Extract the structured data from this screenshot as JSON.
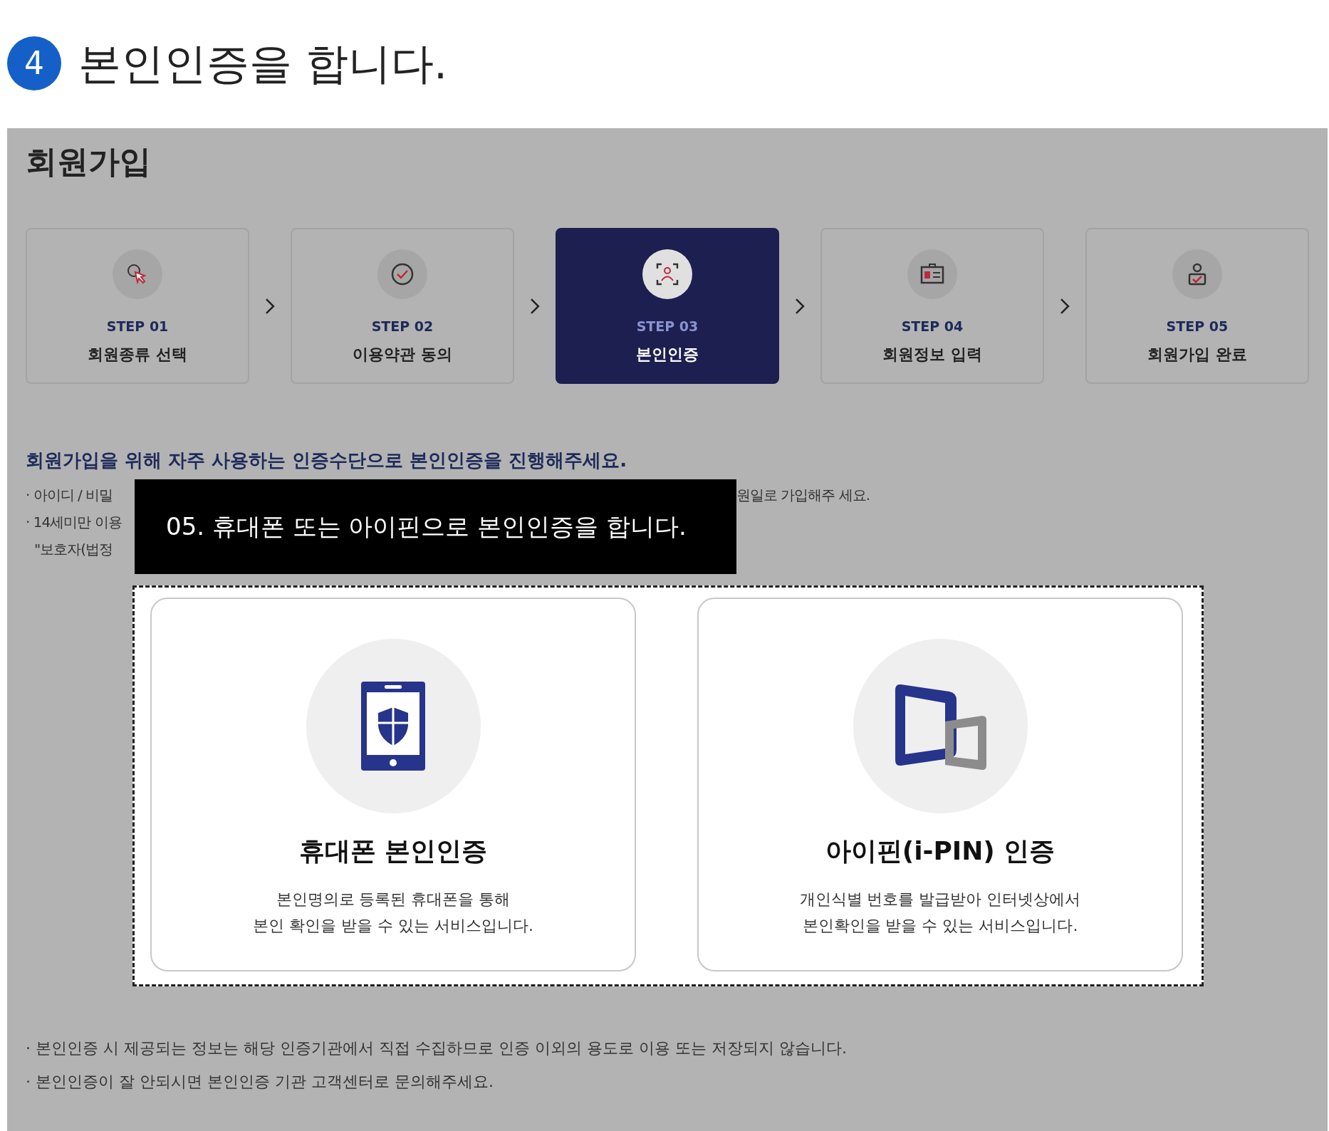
{
  "header": {
    "number": "4",
    "title": "본인인증을 합니다."
  },
  "panel": {
    "title": "회원가입",
    "steps": [
      {
        "label": "STEP 01",
        "name": "회원종류 선택",
        "selected": false
      },
      {
        "label": "STEP 02",
        "name": "이용약관 동의",
        "selected": false
      },
      {
        "label": "STEP 03",
        "name": "본인인증",
        "selected": true
      },
      {
        "label": "STEP 04",
        "name": "회원정보 입력",
        "selected": false
      },
      {
        "label": "STEP 05",
        "name": "회원가입 완료",
        "selected": false
      }
    ],
    "intro": "회원가입을 위해 자주 사용하는 인증수단으로 본인인증을 진행해주세요.",
    "notes": [
      {
        "left": "· 아이디 / 비밀",
        "right": "원일로 가입해주 세요."
      },
      {
        "left": "· 14세미만 이용"
      },
      {
        "left": "\"보호자(법정"
      }
    ],
    "overlay_caption": "05. 휴대폰 또는 아이핀으로 본인인증을 합니다.",
    "options": [
      {
        "kind": "phone",
        "title": "휴대폰 본인인증",
        "description": [
          "본인명의로 등록된 휴대폰을 통해",
          "본인 확인을 받을 수 있는 서비스입니다."
        ]
      },
      {
        "kind": "ipin",
        "title": "아이핀(i-PIN) 인증",
        "description": [
          "개인식별 번호를 발급받아 인터넷상에서",
          "본인확인을 받을 수 있는 서비스입니다."
        ]
      }
    ],
    "footer_notes": [
      "· 본인인증 시 제공되는 정보는 해당 인증기관에서 직접 수집하므로 인증 이외의 용도로 이용 또는 저장되지 않습니다.",
      "· 본인인증이 잘 안되시면 본인인증 기관 고객센터로 문의해주세요."
    ]
  }
}
